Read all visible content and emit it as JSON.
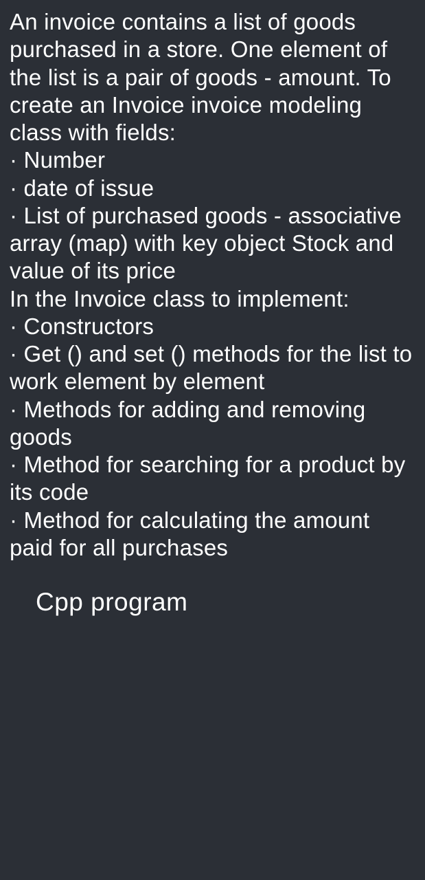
{
  "paragraph1": "An invoice contains a list of goods purchased in a store.  One element of the list is a pair of goods - amount.  To create an Invoice invoice modeling class with fields:",
  "bullet1": " · Number",
  "bullet2": " ·       date of issue",
  "bullet3": " · List of purchased goods - associative array (map) with key object Stock and value of its price",
  "paragraph2": " In the Invoice class to implement:",
  "bullet4": " · Constructors",
  "bullet5": " · Get () and set () methods for the list to work element by element",
  "bullet6": " · Methods for adding and removing goods",
  "bullet7": " · Method for searching for a product by its code",
  "bullet8": " · Method for calculating the amount paid for all purchases",
  "footer": "Cpp program"
}
